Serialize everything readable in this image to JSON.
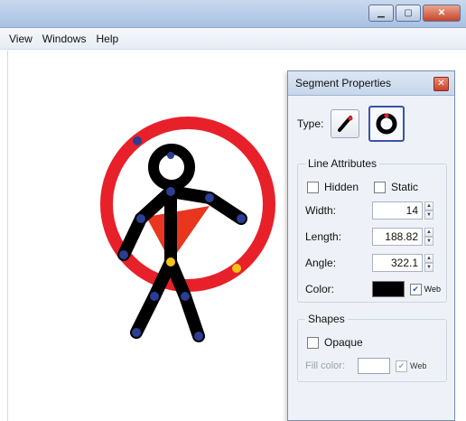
{
  "window": {
    "controls": {
      "minimize": "▁",
      "maximize": "▢",
      "close": "✕"
    }
  },
  "menu": {
    "items": [
      "View",
      "Windows",
      "Help"
    ]
  },
  "canvas": {
    "figure_colors": {
      "ring": "#e8202a",
      "body": "#000000",
      "joint": "#2b3e93",
      "joint_highlight": "#f3c316",
      "shield": "#e8361f"
    }
  },
  "panel": {
    "title": "Segment Properties",
    "close_glyph": "✕",
    "type_label": "Type:",
    "type_options": [
      {
        "icon": "line-segment-icon",
        "selected": false
      },
      {
        "icon": "circle-segment-icon",
        "selected": true
      }
    ],
    "line_attributes": {
      "title": "Line Attributes",
      "hidden_label": "Hidden",
      "static_label": "Static",
      "width_label": "Width:",
      "width_value": "14",
      "length_label": "Length:",
      "length_value": "188.82",
      "angle_label": "Angle:",
      "angle_value": "322.1",
      "color_label": "Color:",
      "color_value": "#000000",
      "web_label": "Web",
      "web_checked": "✔"
    },
    "shapes": {
      "title": "Shapes",
      "opaque_label": "Opaque",
      "fill_color_label": "Fill color:",
      "web_label": "Web",
      "web_checked": "✔"
    }
  }
}
